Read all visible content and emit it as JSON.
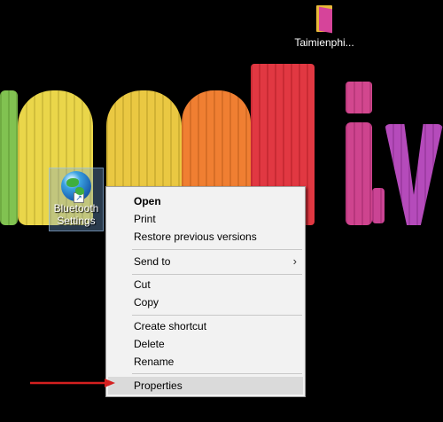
{
  "desktop": {
    "folder_icon": {
      "label": "Taimienphi..."
    },
    "bluetooth_icon": {
      "label": "Bluetooth Settings"
    }
  },
  "context_menu": {
    "items": [
      {
        "label": "Open",
        "bold": true
      },
      {
        "label": "Print"
      },
      {
        "label": "Restore previous versions"
      },
      {
        "label": "Send to",
        "submenu": true
      },
      {
        "label": "Cut"
      },
      {
        "label": "Copy"
      },
      {
        "label": "Create shortcut"
      },
      {
        "label": "Delete"
      },
      {
        "label": "Rename"
      },
      {
        "label": "Properties",
        "highlighted": true
      }
    ],
    "submenu_arrow": "›"
  },
  "annotation": {
    "arrow_color": "#d42020"
  },
  "wallpaper": {
    "colors": {
      "green": "#7cc04a",
      "yellow": "#e9d443",
      "orange": "#ef7a2a",
      "red": "#e0303a",
      "magenta": "#d0408a",
      "pink": "#cc3c8a",
      "purple": "#b244b8"
    }
  }
}
